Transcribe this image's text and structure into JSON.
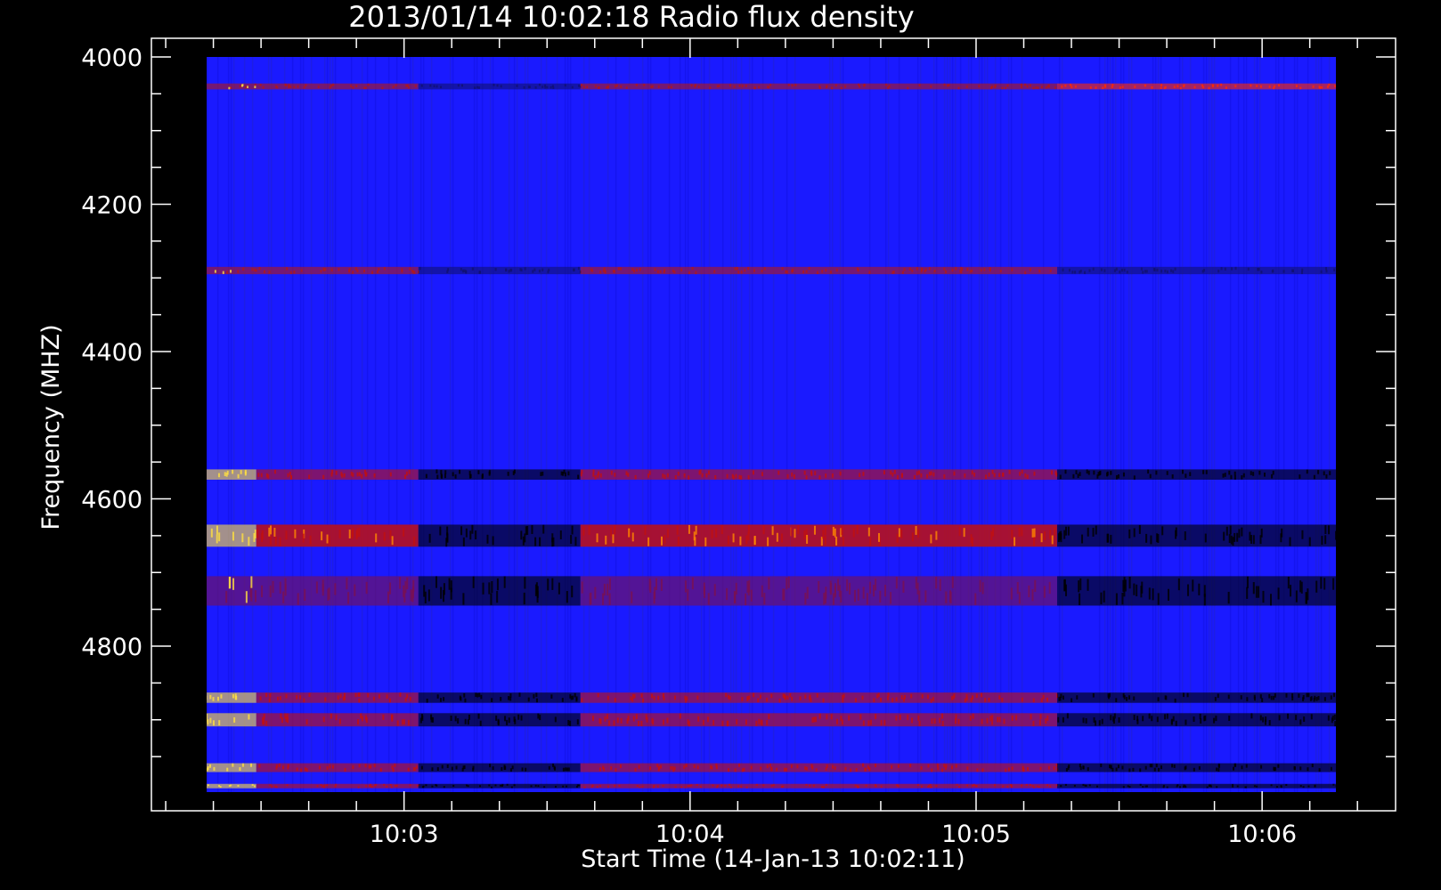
{
  "chart_data": {
    "type": "heatmap",
    "title": "2013/01/14 10:02:18 Radio flux density",
    "xlabel": "Start Time (14-Jan-13 10:02:11)",
    "ylabel": "Frequency (MHZ)",
    "x_ticks": [
      "10:03",
      "10:04",
      "10:05",
      "10:06"
    ],
    "y_ticks": [
      "4000",
      "4200",
      "4400",
      "4600",
      "4800"
    ],
    "xlim_seconds_after_10_00": [
      127,
      388
    ],
    "ylim": [
      4000,
      5000
    ],
    "data_time_range": [
      "10:02:18",
      "10:06:18"
    ],
    "data_frequency_range": [
      4000,
      4995
    ],
    "colormap": [
      "#000000",
      "#2020c0",
      "#1a1aff",
      "#c01010",
      "#ff2a00",
      "#ff8800",
      "#ffe040"
    ],
    "background_color": "#1a1aff",
    "time_segments": [
      {
        "start": "10:02:18",
        "end": "10:02:29",
        "activity": "bright"
      },
      {
        "start": "10:02:29",
        "end": "10:03:03",
        "activity": "red"
      },
      {
        "start": "10:03:03",
        "end": "10:03:37",
        "activity": "dark"
      },
      {
        "start": "10:03:37",
        "end": "10:04:21",
        "activity": "red"
      },
      {
        "start": "10:04:21",
        "end": "10:05:17",
        "activity": "red"
      },
      {
        "start": "10:05:17",
        "end": "10:06:18",
        "activity": "dark"
      }
    ],
    "frequency_bands_mhz": [
      {
        "center": 4040,
        "width": 8,
        "note": "red line, strongest after 10:05:17"
      },
      {
        "center": 4290,
        "width": 10,
        "note": "faint red line"
      },
      {
        "center": 4567,
        "width": 14,
        "note": "red / dark band"
      },
      {
        "center": 4650,
        "width": 30,
        "note": "strongest band, yellow-orange at start"
      },
      {
        "center": 4725,
        "width": 40,
        "note": "dark absorption band"
      },
      {
        "center": 4870,
        "width": 14,
        "note": "red band"
      },
      {
        "center": 4900,
        "width": 18,
        "note": "red / orange band"
      },
      {
        "center": 4965,
        "width": 12,
        "note": "dark band"
      },
      {
        "center": 4990,
        "width": 6,
        "note": "bright edge line"
      }
    ]
  }
}
